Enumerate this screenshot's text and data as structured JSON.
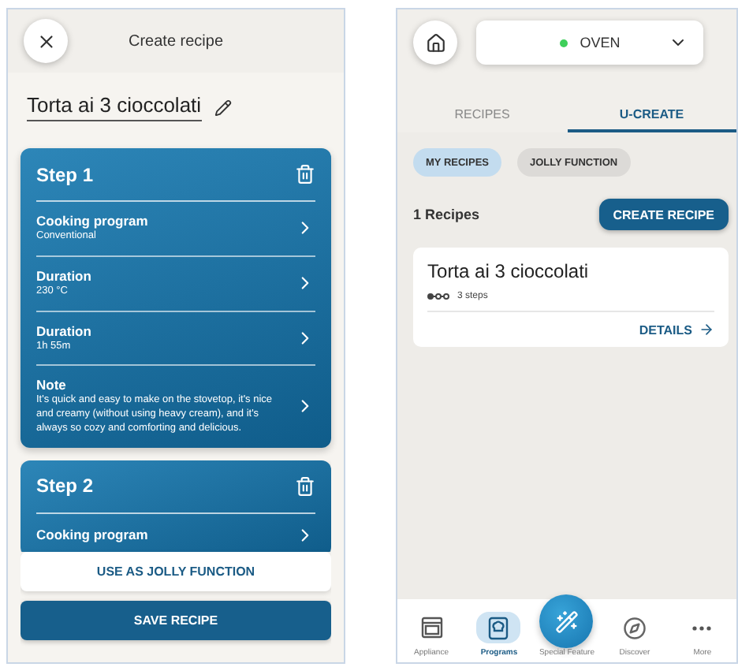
{
  "create_screen": {
    "title": "Create recipe",
    "recipe_name": "Torta ai 3 cioccolati",
    "steps": [
      {
        "title": "Step 1",
        "rows": [
          {
            "label": "Cooking program",
            "value": "Conventional"
          },
          {
            "label": "Duration",
            "value": "230 °C"
          },
          {
            "label": "Duration",
            "value": "1h 55m"
          },
          {
            "label": "Note",
            "value": "It's quick and easy to make on the stovetop, it's nice and creamy (without using heavy cream), and it's always so cozy and comforting and delicious."
          }
        ]
      },
      {
        "title": "Step 2",
        "rows": [
          {
            "label": "Cooking program"
          }
        ]
      }
    ],
    "jolly_button": "USE AS JOLLY FUNCTION",
    "save_button": "SAVE RECIPE"
  },
  "programs_screen": {
    "appliance": {
      "name": "OVEN",
      "online": true
    },
    "tabs": [
      {
        "label": "RECIPES",
        "selected": false
      },
      {
        "label": "U-CREATE",
        "selected": true
      }
    ],
    "chips": [
      {
        "label": "MY RECIPES",
        "selected": true
      },
      {
        "label": "JOLLY FUNCTION",
        "selected": false
      }
    ],
    "count": "1 Recipes",
    "create_button": "CREATE RECIPE",
    "recipes": [
      {
        "name": "Torta ai 3 cioccolati",
        "steps": "3 steps",
        "action": "DETAILS"
      }
    ],
    "nav": [
      {
        "label": "Appliance",
        "kind": "appliance",
        "selected": false
      },
      {
        "label": "Programs",
        "kind": "programs",
        "selected": true
      },
      {
        "label": "Special Feature",
        "kind": "special",
        "selected": false
      },
      {
        "label": "Discover",
        "kind": "discover",
        "selected": false
      },
      {
        "label": "More",
        "kind": "more",
        "selected": false
      }
    ]
  }
}
